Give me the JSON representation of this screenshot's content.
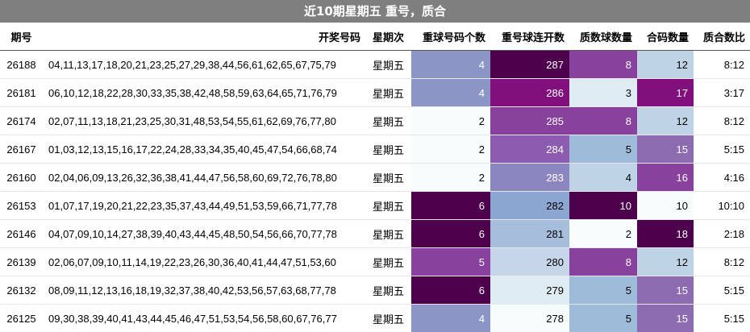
{
  "title": "近10期星期五 重号，质合",
  "headers": [
    "期号",
    "开奖号码",
    "星期次",
    "重球号码个数",
    "重号球连开数",
    "质数球数量",
    "合码数量",
    "质合数比"
  ],
  "rows": [
    {
      "issue": "26188",
      "numbers": "04,11,13,17,18,20,21,23,25,27,29,38,44,56,61,62,65,67,75,79",
      "weekday": "星期五",
      "repeat_count": "4",
      "repeat_streak": "287",
      "prime_count": "8",
      "composite_count": "12",
      "ratio": "8:12",
      "colors": {
        "repeat_count": "#8c96c6",
        "repeat_streak": "#4d004b",
        "prime_count": "#88419d",
        "composite_count": "#bfd3e6"
      }
    },
    {
      "issue": "26181",
      "numbers": "06,10,12,18,22,28,30,33,35,38,42,48,58,59,63,64,65,71,76,79",
      "weekday": "星期五",
      "repeat_count": "4",
      "repeat_streak": "286",
      "prime_count": "3",
      "composite_count": "17",
      "ratio": "3:17",
      "colors": {
        "repeat_count": "#8c96c6",
        "repeat_streak": "#810f7c",
        "prime_count": "#e0ecf4",
        "composite_count": "#810f7c"
      }
    },
    {
      "issue": "26174",
      "numbers": "02,07,11,13,18,21,23,25,30,31,48,53,54,55,61,62,69,76,77,80",
      "weekday": "星期五",
      "repeat_count": "2",
      "repeat_streak": "285",
      "prime_count": "8",
      "composite_count": "12",
      "ratio": "8:12",
      "colors": {
        "repeat_count": "#f7fcfd",
        "repeat_streak": "#88419d",
        "prime_count": "#88419d",
        "composite_count": "#bfd3e6"
      }
    },
    {
      "issue": "26167",
      "numbers": "01,03,12,13,15,16,17,22,24,28,33,34,35,40,45,47,54,66,68,74",
      "weekday": "星期五",
      "repeat_count": "2",
      "repeat_streak": "284",
      "prime_count": "5",
      "composite_count": "15",
      "ratio": "5:15",
      "colors": {
        "repeat_count": "#f7fcfd",
        "repeat_streak": "#8c5cb0",
        "prime_count": "#9ebcda",
        "composite_count": "#8c6bb1"
      }
    },
    {
      "issue": "26160",
      "numbers": "02,04,06,09,13,26,32,36,38,41,44,47,56,58,60,69,72,76,78,80",
      "weekday": "星期五",
      "repeat_count": "2",
      "repeat_streak": "283",
      "prime_count": "4",
      "composite_count": "16",
      "ratio": "4:16",
      "colors": {
        "repeat_count": "#f7fcfd",
        "repeat_streak": "#8c86c0",
        "prime_count": "#bfd3e6",
        "composite_count": "#88419d"
      }
    },
    {
      "issue": "26153",
      "numbers": "01,07,17,19,20,21,22,23,35,37,43,44,49,51,53,59,66,71,77,78",
      "weekday": "星期五",
      "repeat_count": "6",
      "repeat_streak": "282",
      "prime_count": "10",
      "composite_count": "10",
      "ratio": "10:10",
      "colors": {
        "repeat_count": "#4d004b",
        "repeat_streak": "#8ca6d2",
        "prime_count": "#4d004b",
        "composite_count": "#f7fcfd"
      }
    },
    {
      "issue": "26146",
      "numbers": "04,07,09,10,14,27,38,39,40,43,44,45,48,50,54,56,66,70,77,78",
      "weekday": "星期五",
      "repeat_count": "6",
      "repeat_streak": "281",
      "prime_count": "2",
      "composite_count": "18",
      "ratio": "2:18",
      "colors": {
        "repeat_count": "#4d004b",
        "repeat_streak": "#a6bddb",
        "prime_count": "#f7fcfd",
        "composite_count": "#4d004b"
      }
    },
    {
      "issue": "26139",
      "numbers": "02,06,07,09,10,11,14,19,22,23,26,30,36,40,41,44,47,51,53,60",
      "weekday": "星期五",
      "repeat_count": "5",
      "repeat_streak": "280",
      "prime_count": "8",
      "composite_count": "12",
      "ratio": "8:12",
      "colors": {
        "repeat_count": "#88419d",
        "repeat_streak": "#c6d6e8",
        "prime_count": "#88419d",
        "composite_count": "#bfd3e6"
      }
    },
    {
      "issue": "26132",
      "numbers": "08,09,11,12,13,16,18,19,32,37,38,40,42,53,56,57,63,68,77,78",
      "weekday": "星期五",
      "repeat_count": "6",
      "repeat_streak": "279",
      "prime_count": "5",
      "composite_count": "15",
      "ratio": "5:15",
      "colors": {
        "repeat_count": "#4d004b",
        "repeat_streak": "#e0ecf4",
        "prime_count": "#9ebcda",
        "composite_count": "#8c6bb1"
      }
    },
    {
      "issue": "26125",
      "numbers": "09,30,38,39,40,41,43,44,45,46,47,51,53,54,56,58,60,67,76,77",
      "weekday": "星期五",
      "repeat_count": "4",
      "repeat_streak": "278",
      "prime_count": "5",
      "composite_count": "15",
      "ratio": "5:15",
      "colors": {
        "repeat_count": "#8c96c6",
        "repeat_streak": "#f7fcfd",
        "prime_count": "#9ebcda",
        "composite_count": "#8c6bb1"
      }
    }
  ]
}
